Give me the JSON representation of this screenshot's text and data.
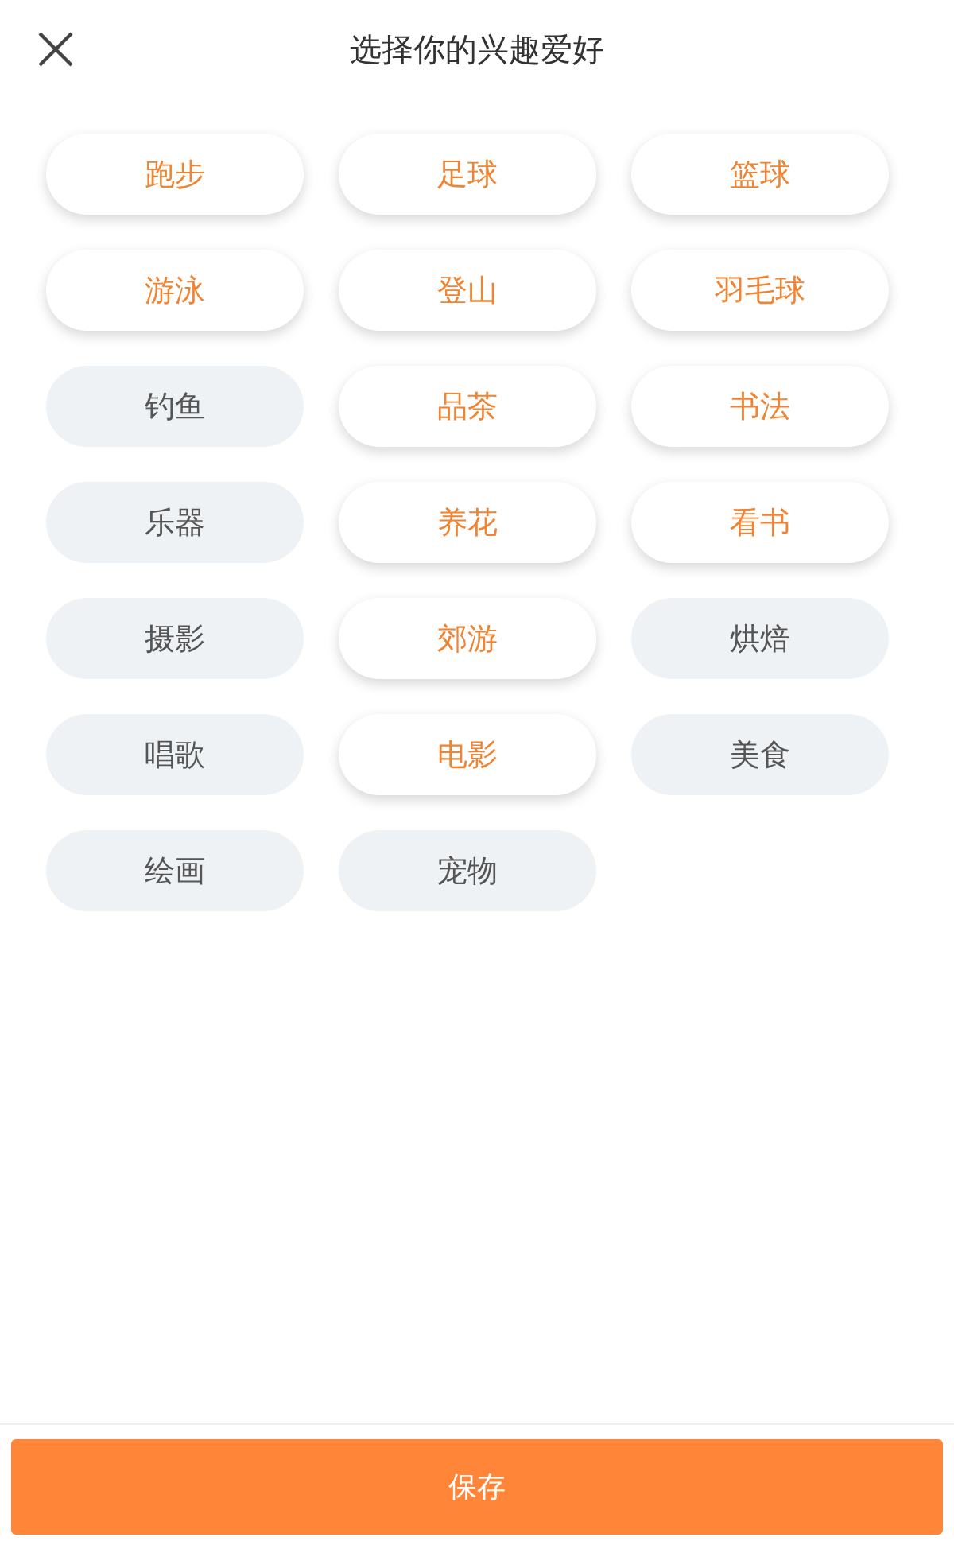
{
  "header": {
    "title": "选择你的兴趣爱好"
  },
  "hobbies": [
    {
      "label": "跑步",
      "selected": true
    },
    {
      "label": "足球",
      "selected": true
    },
    {
      "label": "篮球",
      "selected": true
    },
    {
      "label": "游泳",
      "selected": true
    },
    {
      "label": "登山",
      "selected": true
    },
    {
      "label": "羽毛球",
      "selected": true
    },
    {
      "label": "钓鱼",
      "selected": false
    },
    {
      "label": "品茶",
      "selected": true
    },
    {
      "label": "书法",
      "selected": true
    },
    {
      "label": "乐器",
      "selected": false
    },
    {
      "label": "养花",
      "selected": true
    },
    {
      "label": "看书",
      "selected": true
    },
    {
      "label": "摄影",
      "selected": false
    },
    {
      "label": "郊游",
      "selected": true
    },
    {
      "label": "烘焙",
      "selected": false
    },
    {
      "label": "唱歌",
      "selected": false
    },
    {
      "label": "电影",
      "selected": true
    },
    {
      "label": "美食",
      "selected": false
    },
    {
      "label": "绘画",
      "selected": false
    },
    {
      "label": "宠物",
      "selected": false
    }
  ],
  "save_button": "保存"
}
